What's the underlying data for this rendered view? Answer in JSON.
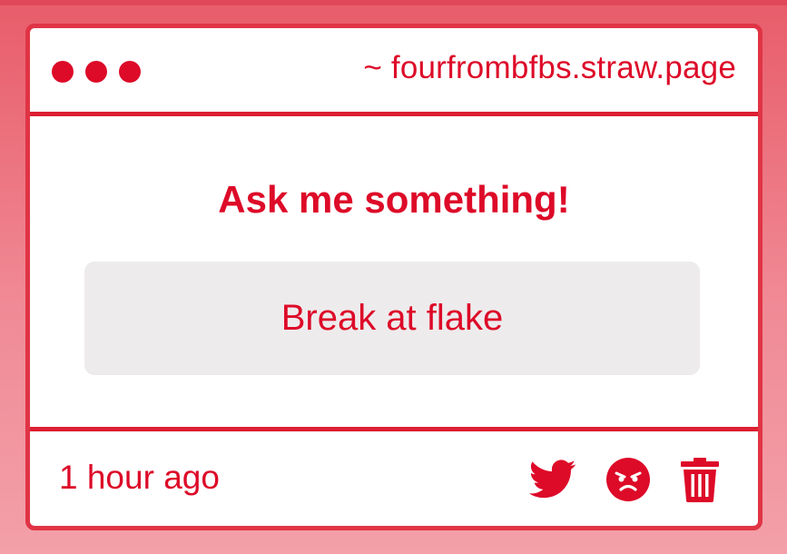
{
  "window": {
    "url": "~ fourfrombfbs.straw.page"
  },
  "main": {
    "heading": "Ask me something!",
    "question": "Break at flake"
  },
  "footer": {
    "timestamp": "1 hour ago",
    "actions": [
      {
        "icon": "twitter-icon"
      },
      {
        "icon": "angry-face-icon"
      },
      {
        "icon": "trash-icon"
      }
    ]
  },
  "colors": {
    "accent": "#dd0a28",
    "border": "#e03445",
    "background_top": "#e85c6a",
    "background_bottom": "#f3a0a9",
    "question_box": "#eeebec"
  }
}
